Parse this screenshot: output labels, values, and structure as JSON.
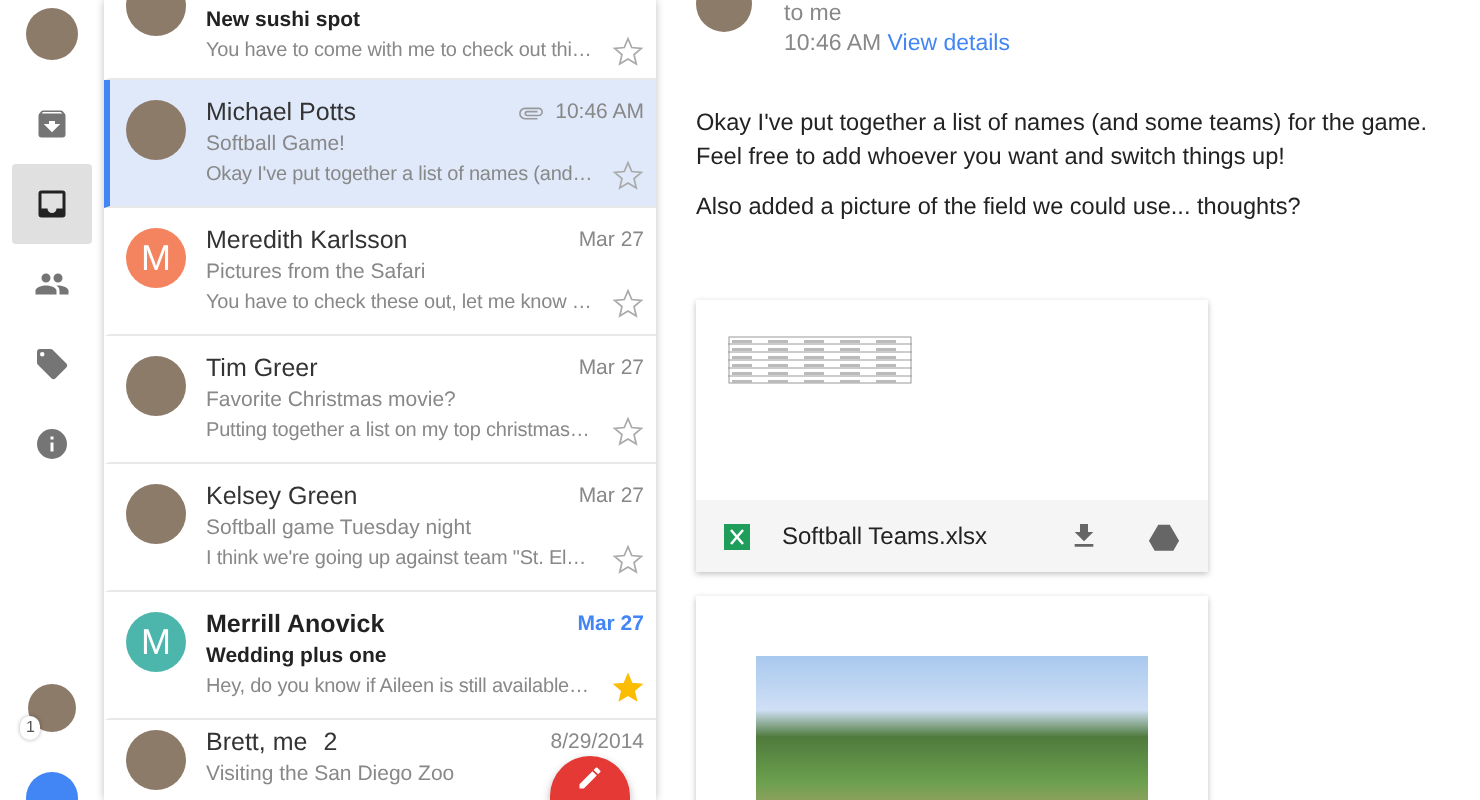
{
  "rail": {
    "items": [
      {
        "kind": "archive",
        "selected": false
      },
      {
        "kind": "inbox",
        "selected": true
      },
      {
        "kind": "people",
        "selected": false
      },
      {
        "kind": "tag",
        "selected": false
      },
      {
        "kind": "info",
        "selected": false
      }
    ],
    "account_badge": "1"
  },
  "messages": [
    {
      "subject": "New sushi spot",
      "snippet": "You have to come with me to check out thi…",
      "unread": true,
      "selected": false,
      "starred": false,
      "avatar": {
        "kind": "photo"
      }
    },
    {
      "sender": "Michael Potts",
      "subject": "Softball Game!",
      "snippet": "Okay I've put together a list of names (and…",
      "date": "10:46 AM",
      "unread": false,
      "selected": true,
      "starred": false,
      "attachment": true,
      "avatar": {
        "kind": "photo"
      }
    },
    {
      "sender": "Meredith Karlsson",
      "subject": "Pictures from the Safari",
      "snippet": "You have to check these out, let me know …",
      "date": "Mar 27",
      "unread": false,
      "selected": false,
      "starred": false,
      "attachment": false,
      "avatar": {
        "kind": "letter",
        "letter": "M",
        "color": "#f4845f"
      }
    },
    {
      "sender": "Tim Greer",
      "subject": "Favorite Christmas movie?",
      "snippet": "Putting together a list on my top christmas…",
      "date": "Mar 27",
      "unread": false,
      "selected": false,
      "starred": false,
      "attachment": false,
      "avatar": {
        "kind": "photo"
      }
    },
    {
      "sender": "Kelsey Green",
      "subject": "Softball game Tuesday night",
      "snippet": "I think we're going up against team \"St. El…",
      "date": "Mar 27",
      "unread": false,
      "selected": false,
      "starred": false,
      "attachment": false,
      "avatar": {
        "kind": "photo"
      }
    },
    {
      "sender": "Merrill Anovick",
      "subject": "Wedding plus one",
      "snippet": "Hey, do you know if Aileen is still available…",
      "date": "Mar 27",
      "unread": true,
      "selected": false,
      "starred": true,
      "attachment": false,
      "avatar": {
        "kind": "letter",
        "letter": "M",
        "color": "#4db6ac"
      }
    },
    {
      "sender": "Brett, me",
      "count": "2",
      "subject": "Visiting the San Diego Zoo",
      "date": "8/29/2014",
      "unread": false,
      "selected": false,
      "avatar": {
        "kind": "photo"
      }
    }
  ],
  "detail": {
    "recipient": "to me",
    "time": "10:46 AM",
    "details_link": "View details",
    "body": [
      "Okay I've put together a list of names (and some teams) for the game.\nFeel free to add whoever you want and switch things up!",
      "Also added a picture of the field we could use... thoughts?"
    ],
    "attachments": [
      {
        "kind": "file",
        "name": "Softball Teams.xlsx"
      },
      {
        "kind": "image"
      }
    ]
  }
}
